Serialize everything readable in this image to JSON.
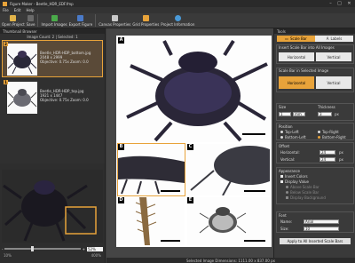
{
  "app": {
    "title": "Figure Maker - Beetle_HDR_EDF.fmp",
    "window_controls": [
      "–",
      "□",
      "✕"
    ]
  },
  "menu": [
    "File",
    "Edit",
    "Help"
  ],
  "toolbar": [
    {
      "label": "Open Project",
      "icon": "folder-icon",
      "color": "#e2b44a"
    },
    {
      "label": "Save",
      "icon": "save-icon",
      "color": "#6a6a6a"
    },
    {
      "label": "Import Images",
      "icon": "import-images-icon",
      "color": "#4aaa4a"
    },
    {
      "label": "Export Figure",
      "icon": "export-figure-icon",
      "color": "#4a7ac8"
    },
    {
      "label": "Canvas Properties",
      "icon": "canvas-properties-icon",
      "color": "#c8c8c8"
    },
    {
      "label": "Grid Properties",
      "icon": "grid-properties-icon",
      "color": "#e8a33a"
    },
    {
      "label": "Project Information",
      "icon": "info-icon",
      "color": "#4a9ad8"
    }
  ],
  "thumbnails": {
    "header": "Thumbnail Browser",
    "count_text": "Image Count: 2 | Selected: 1",
    "items": [
      {
        "badge": "2",
        "name": "Beetle_HDR-HDP_bottom.jpg",
        "size": "2048 x 2999",
        "objective": "Objective: 0.75x  Zoom: 0.0"
      },
      {
        "badge": "1",
        "name": "Beetle_HDR-HDP_top.jpg",
        "size": "1921 x 1447",
        "objective": "Objective: 0.75x  Zoom: 0.0"
      }
    ]
  },
  "navigator": {
    "zoom_value": "52%",
    "min_label": "10%",
    "max_label": "400%"
  },
  "canvas": {
    "panels": [
      "A",
      "B",
      "C",
      "D",
      "E"
    ]
  },
  "status": "Selected Image Dimensions: 1111.00 x 837.00 px",
  "tools": {
    "header": "Tools",
    "tabs": [
      {
        "label": "Scale Bar",
        "active": true
      },
      {
        "label": "Labels",
        "active": false
      }
    ],
    "insert_all_title": "Insert Scale Bar into All Images",
    "insert_all_opts": [
      "Horizontal",
      "Vertical"
    ],
    "selected_title": "Scale Bar in Selected Image",
    "selected_opts": [
      "Horizontal",
      "Vertical"
    ],
    "size": {
      "title": "Size",
      "value": "1",
      "unit": "mm",
      "thickness_label": "Thickness",
      "thickness_value": "3",
      "thickness_unit": "px"
    },
    "position": {
      "title": "Position",
      "options": [
        "Top-Left",
        "Top-Right",
        "Bottom-Left",
        "Bottom-Right"
      ],
      "selected": "Bottom-Right"
    },
    "offset": {
      "title": "Offset",
      "h_label": "Horizontal:",
      "h_value": "24",
      "v_label": "Vertical:",
      "v_value": "24",
      "unit": "px"
    },
    "appearance": {
      "title": "Appearance",
      "invert": "Invert Colors",
      "display": "Display Value",
      "above": "Above Scale Bar",
      "below": "Below Scale Bar",
      "bg": "Display Background"
    },
    "font": {
      "title": "Font",
      "name_label": "Name:",
      "name_value": "Arial",
      "size_label": "Size:",
      "size_value": "10"
    },
    "apply": "Apply to All Inserted Scale Bars"
  },
  "colors": {
    "accent": "#e8a33a",
    "bg": "#3c3c3c"
  }
}
